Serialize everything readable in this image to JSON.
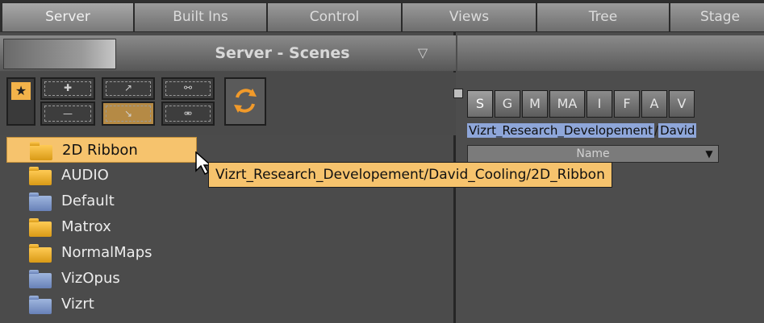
{
  "menu": {
    "tabs": [
      "Server",
      "Built Ins",
      "Control",
      "Views",
      "Tree",
      "Stage"
    ]
  },
  "panel": {
    "title": "Server - Scenes"
  },
  "tree": {
    "items": [
      {
        "label": "2D Ribbon",
        "folder": "orange",
        "selected": true
      },
      {
        "label": "AUDIO",
        "folder": "orange"
      },
      {
        "label": "Default",
        "folder": "blue"
      },
      {
        "label": "Matrox",
        "folder": "orange"
      },
      {
        "label": "NormalMaps",
        "folder": "orange"
      },
      {
        "label": "VizOpus",
        "folder": "blue"
      },
      {
        "label": "Vizrt",
        "folder": "blue"
      }
    ]
  },
  "tooltip": {
    "text": "Vizrt_Research_Developement/David_Cooling/2D_Ribbon"
  },
  "right": {
    "letter_tabs": [
      "S",
      "G",
      "M",
      "MA",
      "I",
      "F",
      "A",
      "V"
    ],
    "path_segments": [
      "Vizrt_Research_Developement",
      "/",
      "David"
    ],
    "column_header": "Name"
  },
  "colors": {
    "selection": "#f6c36d",
    "path_highlight": "#8ea6d9"
  }
}
